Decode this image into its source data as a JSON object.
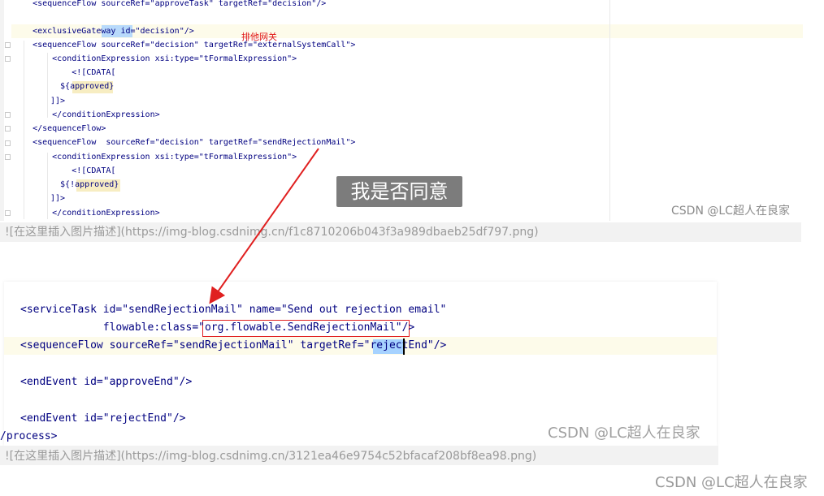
{
  "top_code": {
    "lines": [
      "    <sequenceFlow sourceRef=\"approveTask\" targetRef=\"decision\"/>",
      "",
      "    <exclusiveGateway id=\"decision\"/>",
      "    <sequenceFlow sourceRef=\"decision\" targetRef=\"externalSystemCall\">",
      "        <conditionExpression xsi:type=\"tFormalExpression\">",
      "            <![CDATA[",
      "  ${approved}",
      "]]>",
      "        </conditionExpression>",
      "    </sequenceFlow>",
      "    <sequenceFlow  sourceRef=\"decision\" targetRef=\"sendRejectionMail\">",
      "        <conditionExpression xsi:type=\"tFormalExpression\">",
      "            <![CDATA[",
      "  ${!approved}",
      "]]>",
      "        </conditionExpression>"
    ],
    "annotation": "排他网关"
  },
  "overlay_label": "我是否同意",
  "watermark": "CSDN @LC超人在良家",
  "captions": {
    "first": "![在这里插入图片描述](https://img-blog.csdnimg.cn/f1c8710206b043f3a989dbaeb25df797.png)",
    "second": "![在这里插入图片描述](https://img-blog.csdnimg.cn/3121ea46e9754c52bfacaf208bf8ea98.png)"
  },
  "bottom_code": {
    "lines": [
      "<serviceTask id=\"sendRejectionMail\" name=\"Send out rejection email\"",
      "             flowable:class=\"org.flowable.SendRejectionMail\"/>",
      "<sequenceFlow sourceRef=\"sendRejectionMail\" targetRef=\"rejectEnd\"/>",
      "",
      "<endEvent id=\"approveEnd\"/>",
      "",
      "",
      "<endEvent id=\"rejectEnd\"/>"
    ],
    "process_end": "/process>"
  },
  "colors": {
    "annotation": "#e01616",
    "highlight_line": "#fdfbea",
    "selection": "#a6d2ff",
    "arrow": "#e02020"
  }
}
